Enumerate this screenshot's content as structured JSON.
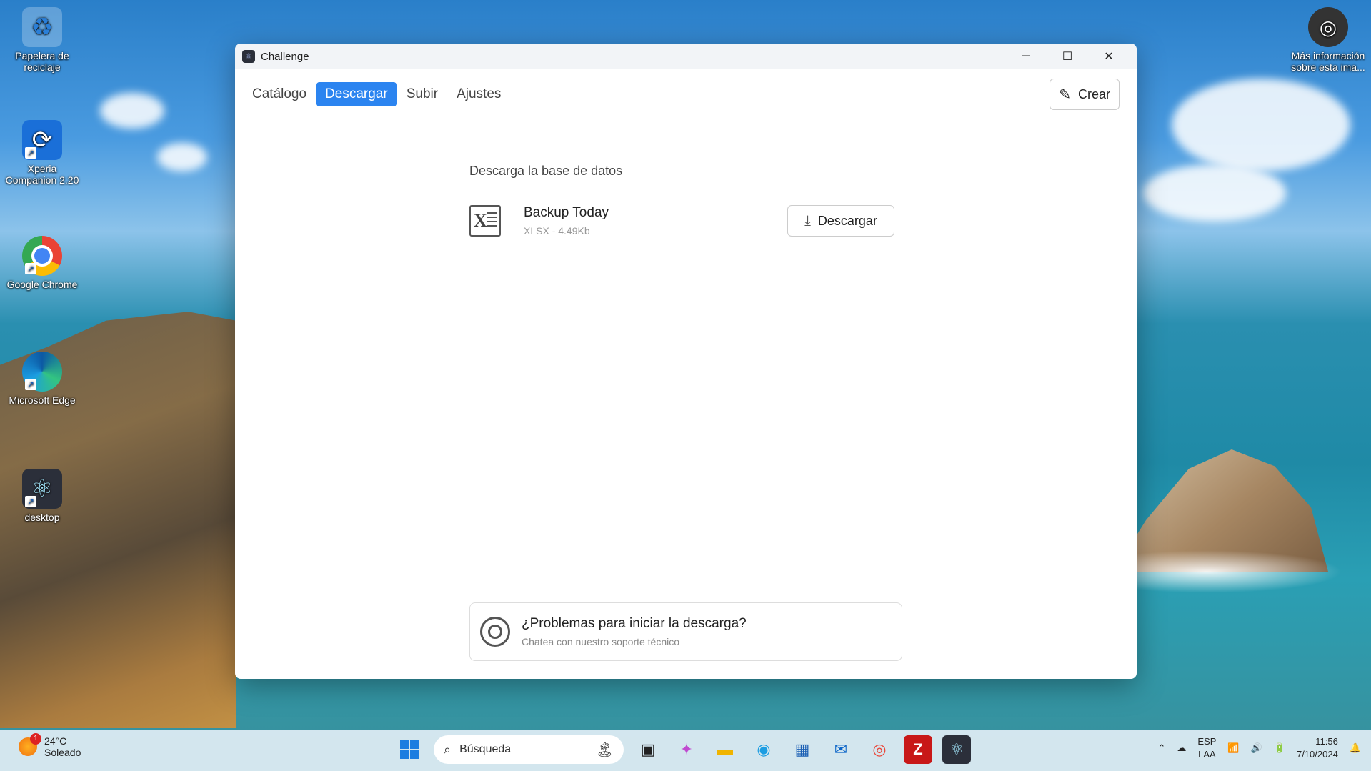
{
  "desktop": {
    "icons": [
      {
        "label": "Papelera de reciclaje",
        "icon": "recycle-bin-icon"
      },
      {
        "label": "Xperia Companion 2.20",
        "icon": "xperia-companion-icon"
      },
      {
        "label": "Google Chrome",
        "icon": "chrome-icon"
      },
      {
        "label": "Microsoft Edge",
        "icon": "edge-icon"
      },
      {
        "label": "desktop",
        "icon": "electron-icon"
      }
    ],
    "spotlight_label": "Más información sobre esta ima..."
  },
  "window": {
    "title": "Challenge",
    "tabs": [
      {
        "label": "Catálogo",
        "active": false
      },
      {
        "label": "Descargar",
        "active": true
      },
      {
        "label": "Subir",
        "active": false
      },
      {
        "label": "Ajustes",
        "active": false
      }
    ],
    "create_label": "Crear",
    "section_title": "Descarga la base de datos",
    "file": {
      "name": "Backup Today",
      "meta": "XLSX - 4.49Kb",
      "icon": "excel-file-icon"
    },
    "download_label": "Descargar",
    "help": {
      "title": "¿Problemas para iniciar la descarga?",
      "subtitle": "Chatea con nuestro soporte técnico"
    },
    "accent_color": "#2b84f0"
  },
  "taskbar": {
    "weather": {
      "temp": "24°C",
      "condition": "Soleado",
      "badge": "1"
    },
    "search_placeholder": "Búsqueda",
    "language": {
      "top": "ESP",
      "bottom": "LAA"
    },
    "clock": {
      "time": "11:56",
      "date": "7/10/2024"
    }
  }
}
